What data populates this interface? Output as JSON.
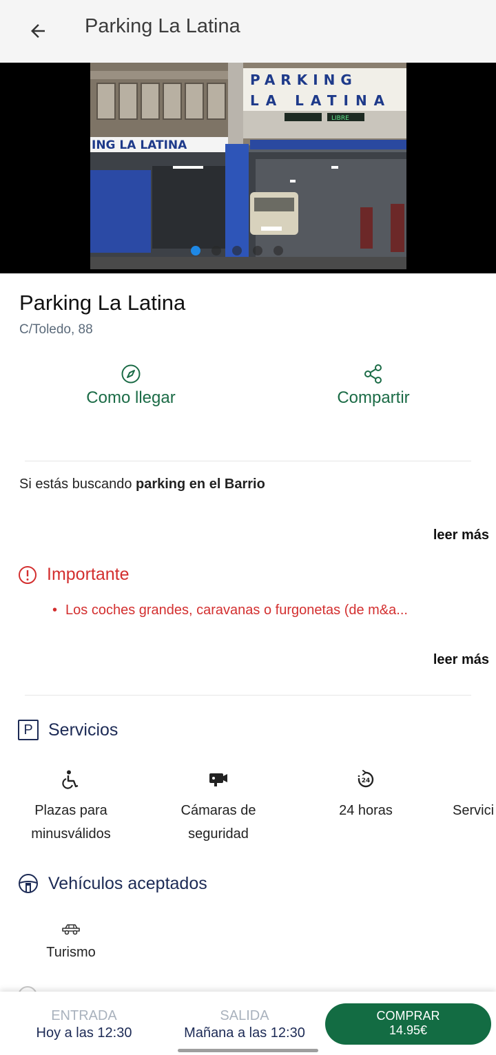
{
  "appbar": {
    "title": "Parking La Latina",
    "back_icon": "arrow-left-icon"
  },
  "gallery": {
    "photo_sign_top": "PARKING",
    "photo_sign_bottom": "LA LATINA",
    "photo_banner": "ING LA LATINA",
    "photo_libre": "LIBRE",
    "dots_count": 5,
    "active_index": 0
  },
  "place": {
    "name": "Parking La Latina",
    "address": "C/Toledo, 88"
  },
  "actions": {
    "route": {
      "label": "Como llegar",
      "icon": "compass-icon"
    },
    "share": {
      "label": "Compartir",
      "icon": "share-icon"
    }
  },
  "description": {
    "prefix": "Si estás buscando ",
    "bold": "parking en el Barrio",
    "read_more": "leer más"
  },
  "important": {
    "title": "Importante",
    "icon": "alert-circle-icon",
    "items": [
      "Los coches grandes, caravanas o furgonetas (de m&a..."
    ],
    "read_more": "leer más"
  },
  "services": {
    "title": "Servicios",
    "header_icon": "P",
    "items": [
      {
        "line1": "Plazas para",
        "line2": "minusválidos",
        "icon": "wheelchair-icon"
      },
      {
        "line1": "Cámaras de",
        "line2": "seguridad",
        "icon": "security-camera-icon"
      },
      {
        "line1": "24 horas",
        "line2": "",
        "icon": "clock-24-icon"
      },
      {
        "line1": "Servici",
        "line2": "",
        "icon": ""
      }
    ]
  },
  "vehicles": {
    "title": "Vehículos  aceptados",
    "icon": "steering-wheel-icon",
    "items": [
      {
        "label": "Turismo",
        "icon": "car-icon"
      }
    ]
  },
  "bottom": {
    "entrada_caption": "ENTRADA",
    "entrada_value": "Hoy a las 12:30",
    "salida_caption": "SALIDA",
    "salida_value": "Mañana a las 12:30",
    "buy_label": "COMPRAR",
    "buy_price": "14.95€",
    "accent_color": "#136c43"
  },
  "colors": {
    "primary_green": "#1b6b46",
    "important_red": "#d32f2f",
    "navy": "#1c2a55",
    "active_dot": "#1e88e5"
  }
}
